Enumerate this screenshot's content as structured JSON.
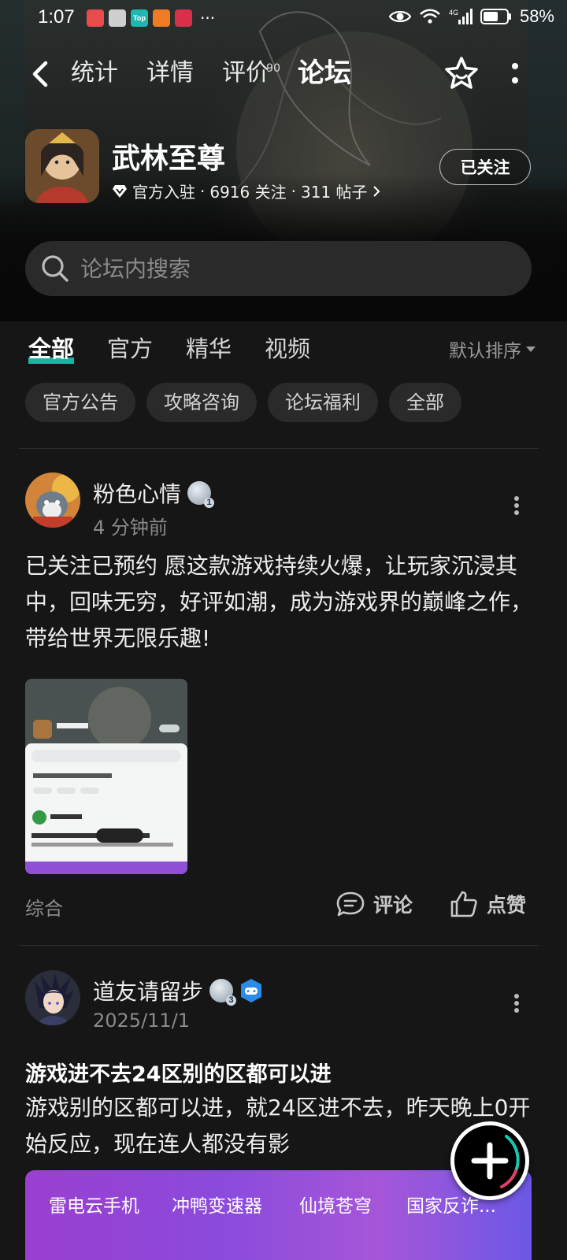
{
  "status_bar": {
    "time": "1:07",
    "battery": "58%",
    "network": "4G",
    "apps": [
      {
        "icon": "notification-app-icon",
        "color": "#e84b4b",
        "label": ""
      },
      {
        "icon": "wechat-icon",
        "color": "#cfcfcf",
        "label": ""
      },
      {
        "icon": "taptap-icon",
        "color": "#1fb8b0",
        "label": "Top"
      },
      {
        "icon": "app-icon",
        "color": "#ef7b25",
        "label": ""
      },
      {
        "icon": "app-icon",
        "color": "#d9304a",
        "label": ""
      }
    ],
    "more": "···"
  },
  "nav": {
    "tabs": [
      {
        "label": "统计",
        "active": false
      },
      {
        "label": "详情",
        "active": false
      },
      {
        "label": "评价",
        "active": false,
        "badge": "90"
      },
      {
        "label": "论坛",
        "active": true
      }
    ]
  },
  "game": {
    "title": "武林至尊",
    "official": "官方入驻",
    "followers": "6916 关注",
    "posts": "311 帖子",
    "sep": "·",
    "follow_button": "已关注"
  },
  "search": {
    "placeholder": "论坛内搜索"
  },
  "sub_tabs": [
    {
      "label": "全部",
      "active": true
    },
    {
      "label": "官方",
      "active": false
    },
    {
      "label": "精华",
      "active": false
    },
    {
      "label": "视频",
      "active": false
    }
  ],
  "sort": {
    "label": "默认排序"
  },
  "chips": [
    "官方公告",
    "攻略咨询",
    "论坛福利",
    "全部"
  ],
  "posts": [
    {
      "username": "粉色心情",
      "level": "1",
      "time": "4 分钟前",
      "text": "已关注已预约 愿这款游戏持续火爆，让玩家沉浸其中，回味无穷，好评如潮，成为游戏界的巅峰之作，带给世界无限乐趣!",
      "tag": "综合",
      "comment_label": "评论",
      "like_label": "点赞"
    },
    {
      "username": "道友请留步",
      "level": "3",
      "time": "2025/11/1",
      "title": "游戏进不去24区别的区都可以进",
      "text": "游戏别的区都可以进，就24区进不去，昨天晚上0开始反应，现在连人都没有影",
      "banner_items": [
        "雷电云手机",
        "冲鸭变速器",
        "仙境苍穹",
        "国家反诈..."
      ]
    }
  ],
  "colors": {
    "accent": "#19c6b0",
    "background": "#161616",
    "chip": "#2a2a2a"
  }
}
